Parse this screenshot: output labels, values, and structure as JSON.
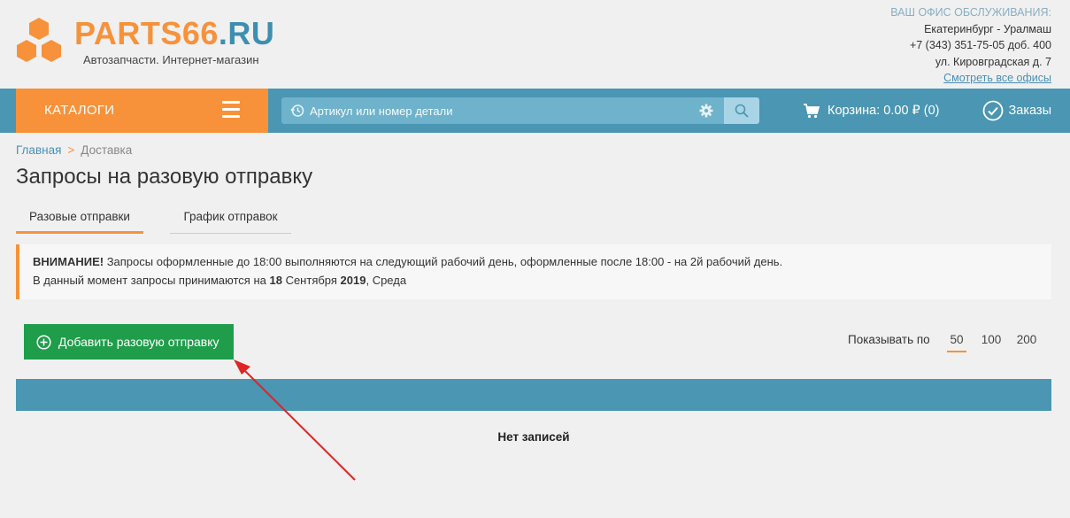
{
  "header": {
    "brand_part1": "PARTS66",
    "brand_part2": ".RU",
    "tagline": "Автозапчасти. Интернет-магазин",
    "office": {
      "title": "ВАШ ОФИС ОБСЛУЖИВАНИЯ:",
      "city": "Екатеринбург - Уралмаш",
      "phone": "+7 (343) 351-75-05 доб. 400",
      "address": "ул. Кировградская д. 7",
      "all_offices_link": "Смотреть все офисы"
    }
  },
  "nav": {
    "catalog_label": "КАТАЛОГИ",
    "search_placeholder": "Артикул или номер детали",
    "cart_label": "Корзина: 0.00 ₽ (0)",
    "orders_label": "Заказы"
  },
  "breadcrumb": {
    "home": "Главная",
    "separator": ">",
    "current": "Доставка"
  },
  "page_title": "Запросы на разовую отправку",
  "tabs": [
    {
      "label": "Разовые отправки",
      "active": true
    },
    {
      "label": "График отправок",
      "active": false
    }
  ],
  "alert": {
    "strong": "ВНИМАНИЕ!",
    "line1": " Запросы оформленные до 18:00 выполняются на следующий рабочий день, оформленные после 18:00 - на 2й рабочий день.",
    "line2_prefix": "В данный момент запросы принимаются на ",
    "date_bold": "18",
    "month": " Сентября ",
    "year_bold": "2019",
    "weekday": ", Среда"
  },
  "actions": {
    "add_button": "Добавить разовую отправку",
    "per_page_label": "Показывать по",
    "per_page_options": [
      "50",
      "100",
      "200"
    ],
    "per_page_selected": "50"
  },
  "table": {
    "empty_message": "Нет записей"
  },
  "colors": {
    "accent_orange": "#f7923a",
    "nav_blue": "#4a96b3",
    "add_green": "#1f9d4a",
    "annotation_arrow": "#e02424"
  }
}
